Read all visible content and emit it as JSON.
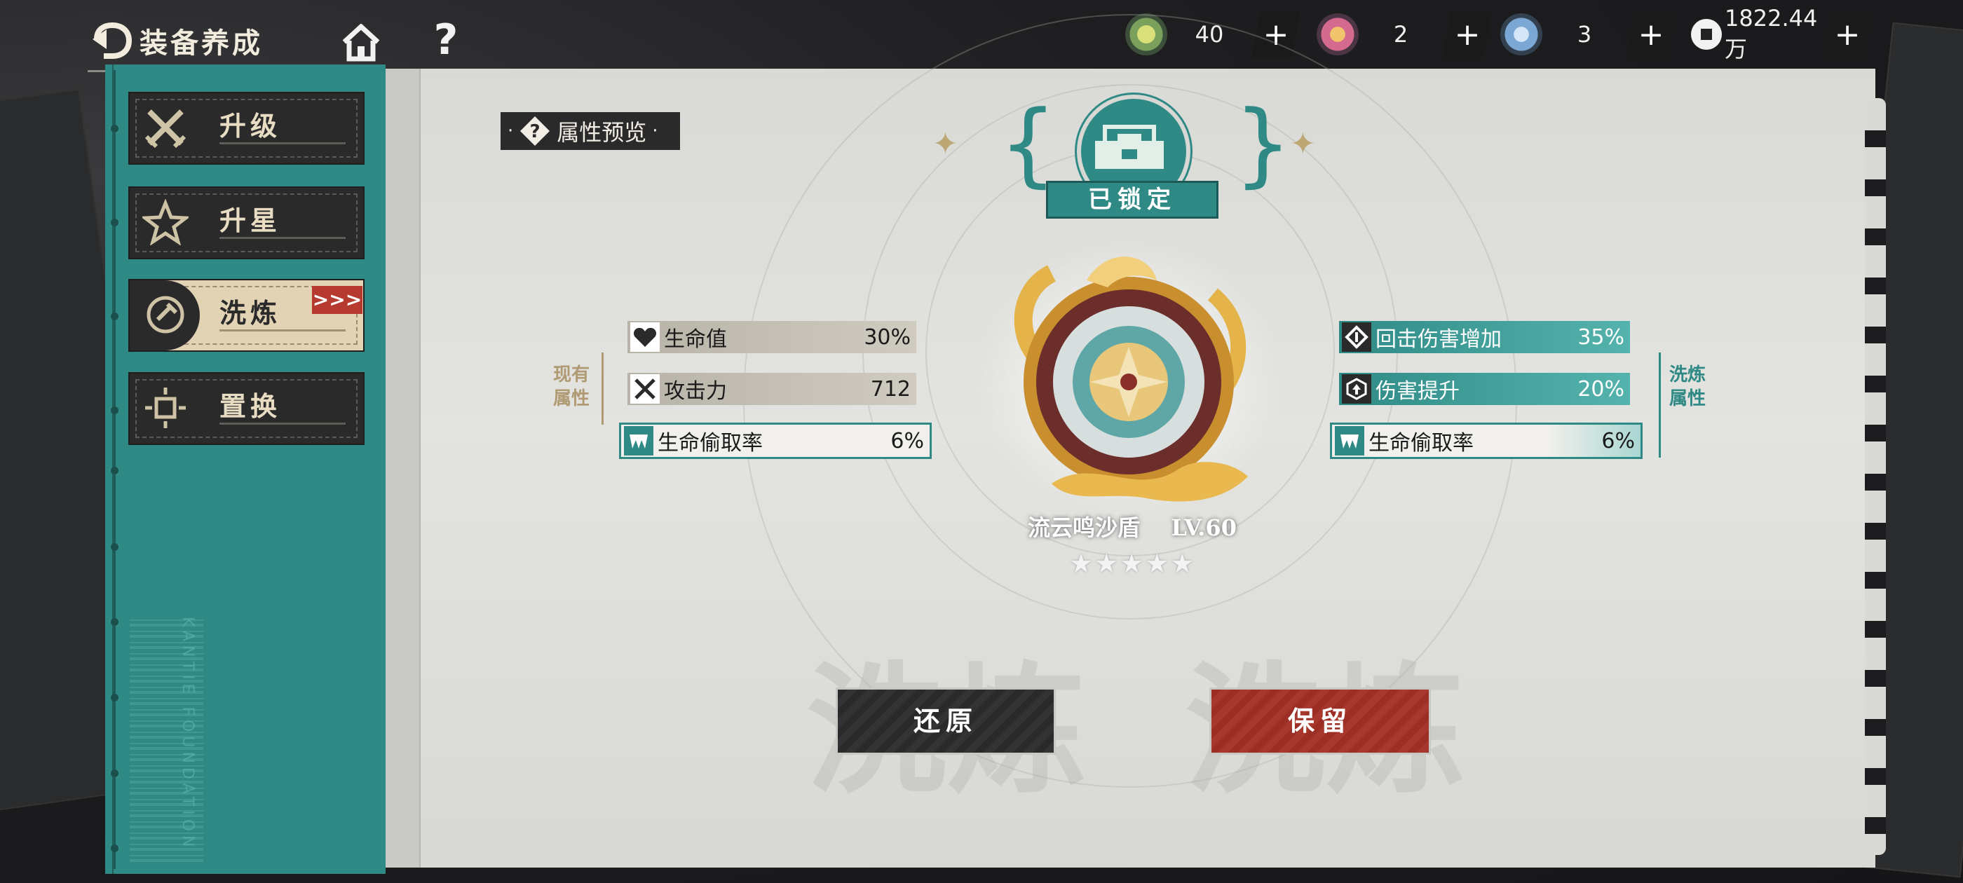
{
  "header": {
    "title": "装备养成"
  },
  "resources": [
    {
      "icon": "swirl-currency-icon",
      "value": "40"
    },
    {
      "icon": "pink-gem-icon",
      "value": "2"
    },
    {
      "icon": "blue-crystal-icon",
      "value": "3"
    },
    {
      "icon": "coin-icon",
      "value": "1822.44万"
    }
  ],
  "sidebar": {
    "items": [
      {
        "label": "升级",
        "icon": "crossed-swords-icon"
      },
      {
        "label": "升星",
        "icon": "star-icon"
      },
      {
        "label": "洗炼",
        "icon": "refine-icon"
      },
      {
        "label": "置换",
        "icon": "swap-icon"
      }
    ],
    "active_index": 2,
    "barcode_text": "KANTIE FOUNDATION"
  },
  "preview": {
    "label": "属性预览"
  },
  "lock": {
    "label": "已锁定"
  },
  "equipment": {
    "name": "流云鸣沙盾",
    "level": "LV.60",
    "stars": 5
  },
  "current": {
    "label": "现有属性",
    "stats": [
      {
        "name": "生命值",
        "value": "30%",
        "icon": "heart-icon"
      },
      {
        "name": "攻击力",
        "value": "712",
        "icon": "crossed-swords-icon"
      },
      {
        "name": "生命偷取率",
        "value": "6%",
        "icon": "fangs-icon"
      }
    ]
  },
  "refined": {
    "label": "洗炼属性",
    "stats": [
      {
        "name": "回击伤害增加",
        "value": "35%",
        "icon": "counter-icon"
      },
      {
        "name": "伤害提升",
        "value": "20%",
        "icon": "damage-up-icon"
      },
      {
        "name": "生命偷取率",
        "value": "6%",
        "icon": "fangs-icon"
      }
    ]
  },
  "buttons": {
    "restore": "还原",
    "keep": "保留"
  },
  "colors": {
    "teal": "#2f8a86",
    "dark": "#2b2a2b",
    "red": "#a8382d",
    "paper": "#dcdcd9"
  }
}
